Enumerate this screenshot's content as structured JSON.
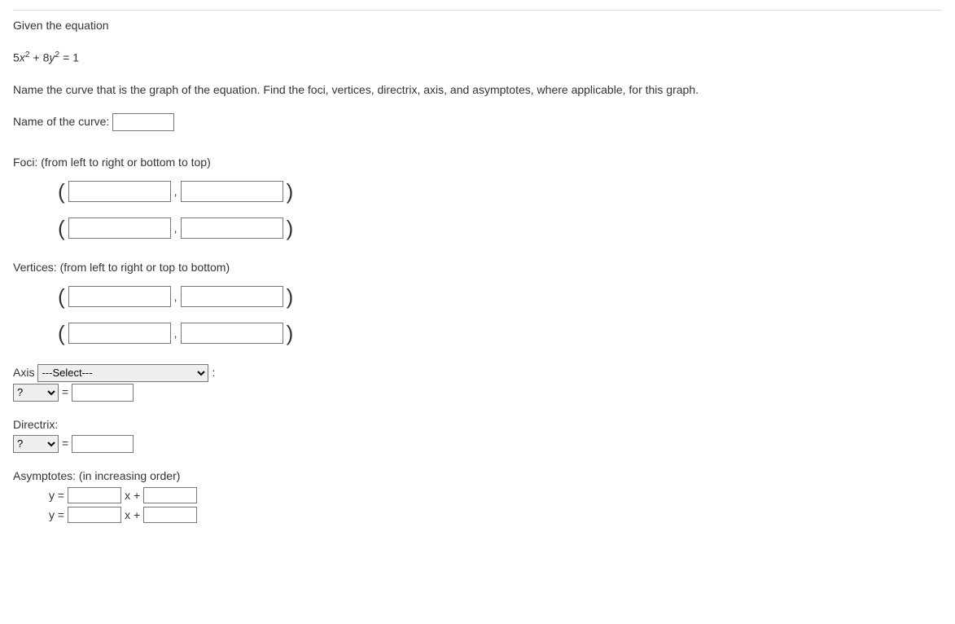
{
  "intro": "Given the equation",
  "equation": {
    "coef1": "5",
    "var1": "x",
    "exp1": "2",
    "plus": " + ",
    "coef2": "8",
    "var2": "y",
    "exp2": "2",
    "eq": " = 1"
  },
  "instruction": "Name the curve that is the graph of the equation. Find the foci, vertices, directrix, axis, and asymptotes, where applicable, for this graph.",
  "name_label": "Name of the curve: ",
  "foci_label": "Foci: (from left to right or bottom to top)",
  "vertices_label": "Vertices: (from left to right or top to bottom)",
  "axis_label": "Axis ",
  "axis_select_placeholder": "---Select---",
  "axis_colon": " :",
  "question_option": "?",
  "equals": " = ",
  "directrix_label": "Directrix:",
  "asymptotes_label": "Asymptotes: (in increasing order)",
  "asym_y": "y =",
  "asym_xplus": "x +",
  "paren_open": "(",
  "paren_close": ")",
  "comma": ","
}
